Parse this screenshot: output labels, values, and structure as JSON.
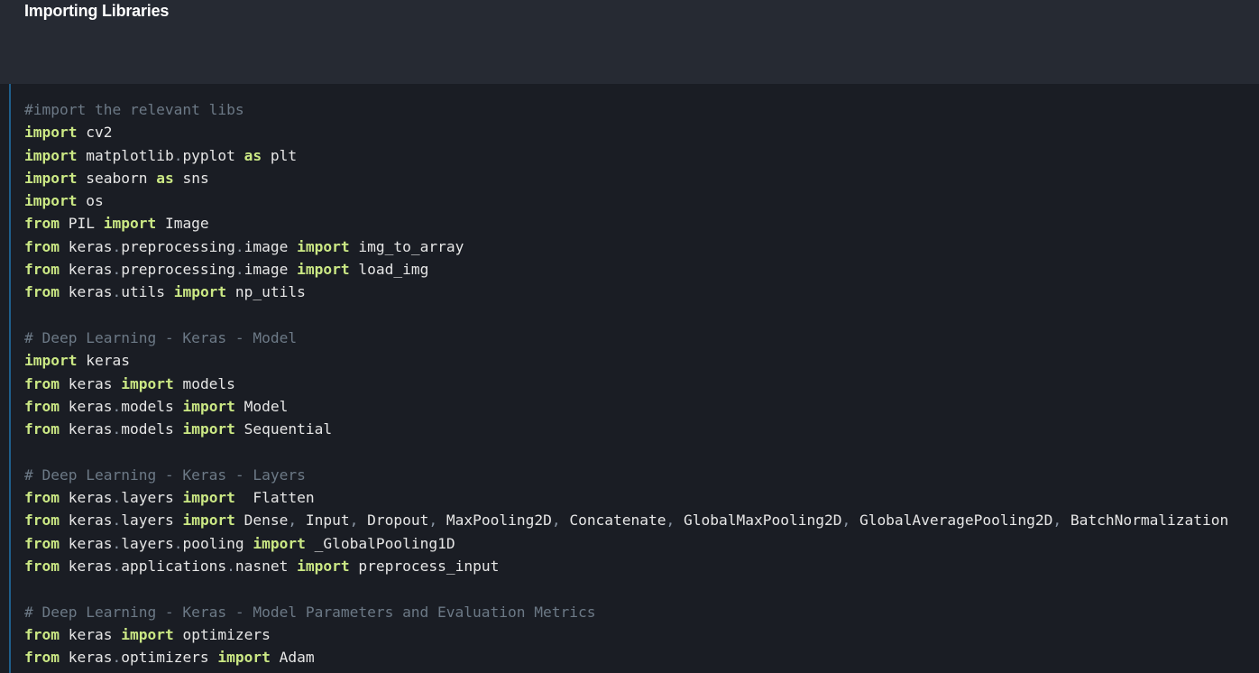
{
  "markdown": {
    "heading": "Importing Libraries"
  },
  "code": {
    "lines": [
      [
        {
          "t": "cm",
          "v": "#import the relevant libs"
        }
      ],
      [
        {
          "t": "kw",
          "v": "import"
        },
        {
          "t": "tx",
          "v": " cv2"
        }
      ],
      [
        {
          "t": "kw",
          "v": "import"
        },
        {
          "t": "tx",
          "v": " matplotlib"
        },
        {
          "t": "op",
          "v": "."
        },
        {
          "t": "tx",
          "v": "pyplot "
        },
        {
          "t": "kw",
          "v": "as"
        },
        {
          "t": "tx",
          "v": " plt"
        }
      ],
      [
        {
          "t": "kw",
          "v": "import"
        },
        {
          "t": "tx",
          "v": " seaborn "
        },
        {
          "t": "kw",
          "v": "as"
        },
        {
          "t": "tx",
          "v": " sns"
        }
      ],
      [
        {
          "t": "kw",
          "v": "import"
        },
        {
          "t": "tx",
          "v": " os"
        }
      ],
      [
        {
          "t": "kw",
          "v": "from"
        },
        {
          "t": "tx",
          "v": " PIL "
        },
        {
          "t": "kw",
          "v": "import"
        },
        {
          "t": "tx",
          "v": " Image"
        }
      ],
      [
        {
          "t": "kw",
          "v": "from"
        },
        {
          "t": "tx",
          "v": " keras"
        },
        {
          "t": "op",
          "v": "."
        },
        {
          "t": "tx",
          "v": "preprocessing"
        },
        {
          "t": "op",
          "v": "."
        },
        {
          "t": "tx",
          "v": "image "
        },
        {
          "t": "kw",
          "v": "import"
        },
        {
          "t": "tx",
          "v": " img_to_array"
        }
      ],
      [
        {
          "t": "kw",
          "v": "from"
        },
        {
          "t": "tx",
          "v": " keras"
        },
        {
          "t": "op",
          "v": "."
        },
        {
          "t": "tx",
          "v": "preprocessing"
        },
        {
          "t": "op",
          "v": "."
        },
        {
          "t": "tx",
          "v": "image "
        },
        {
          "t": "kw",
          "v": "import"
        },
        {
          "t": "tx",
          "v": " load_img"
        }
      ],
      [
        {
          "t": "kw",
          "v": "from"
        },
        {
          "t": "tx",
          "v": " keras"
        },
        {
          "t": "op",
          "v": "."
        },
        {
          "t": "tx",
          "v": "utils "
        },
        {
          "t": "kw",
          "v": "import"
        },
        {
          "t": "tx",
          "v": " np_utils"
        }
      ],
      [],
      [
        {
          "t": "cm",
          "v": "# Deep Learning - Keras - Model"
        }
      ],
      [
        {
          "t": "kw",
          "v": "import"
        },
        {
          "t": "tx",
          "v": " keras"
        }
      ],
      [
        {
          "t": "kw",
          "v": "from"
        },
        {
          "t": "tx",
          "v": " keras "
        },
        {
          "t": "kw",
          "v": "import"
        },
        {
          "t": "tx",
          "v": " models"
        }
      ],
      [
        {
          "t": "kw",
          "v": "from"
        },
        {
          "t": "tx",
          "v": " keras"
        },
        {
          "t": "op",
          "v": "."
        },
        {
          "t": "tx",
          "v": "models "
        },
        {
          "t": "kw",
          "v": "import"
        },
        {
          "t": "tx",
          "v": " Model"
        }
      ],
      [
        {
          "t": "kw",
          "v": "from"
        },
        {
          "t": "tx",
          "v": " keras"
        },
        {
          "t": "op",
          "v": "."
        },
        {
          "t": "tx",
          "v": "models "
        },
        {
          "t": "kw",
          "v": "import"
        },
        {
          "t": "tx",
          "v": " Sequential"
        }
      ],
      [],
      [
        {
          "t": "cm",
          "v": "# Deep Learning - Keras - Layers"
        }
      ],
      [
        {
          "t": "kw",
          "v": "from"
        },
        {
          "t": "tx",
          "v": " keras"
        },
        {
          "t": "op",
          "v": "."
        },
        {
          "t": "tx",
          "v": "layers "
        },
        {
          "t": "kw",
          "v": "import"
        },
        {
          "t": "tx",
          "v": "  Flatten"
        }
      ],
      [
        {
          "t": "kw",
          "v": "from"
        },
        {
          "t": "tx",
          "v": " keras"
        },
        {
          "t": "op",
          "v": "."
        },
        {
          "t": "tx",
          "v": "layers "
        },
        {
          "t": "kw",
          "v": "import"
        },
        {
          "t": "tx",
          "v": " Dense"
        },
        {
          "t": "op",
          "v": ","
        },
        {
          "t": "tx",
          "v": " Input"
        },
        {
          "t": "op",
          "v": ","
        },
        {
          "t": "tx",
          "v": " Dropout"
        },
        {
          "t": "op",
          "v": ","
        },
        {
          "t": "tx",
          "v": " MaxPooling2D"
        },
        {
          "t": "op",
          "v": ","
        },
        {
          "t": "tx",
          "v": " Concatenate"
        },
        {
          "t": "op",
          "v": ","
        },
        {
          "t": "tx",
          "v": " GlobalMaxPooling2D"
        },
        {
          "t": "op",
          "v": ","
        },
        {
          "t": "tx",
          "v": " GlobalAveragePooling2D"
        },
        {
          "t": "op",
          "v": ","
        },
        {
          "t": "tx",
          "v": " BatchNormalization"
        }
      ],
      [
        {
          "t": "kw",
          "v": "from"
        },
        {
          "t": "tx",
          "v": " keras"
        },
        {
          "t": "op",
          "v": "."
        },
        {
          "t": "tx",
          "v": "layers"
        },
        {
          "t": "op",
          "v": "."
        },
        {
          "t": "tx",
          "v": "pooling "
        },
        {
          "t": "kw",
          "v": "import"
        },
        {
          "t": "tx",
          "v": " _GlobalPooling1D"
        }
      ],
      [
        {
          "t": "kw",
          "v": "from"
        },
        {
          "t": "tx",
          "v": " keras"
        },
        {
          "t": "op",
          "v": "."
        },
        {
          "t": "tx",
          "v": "applications"
        },
        {
          "t": "op",
          "v": "."
        },
        {
          "t": "tx",
          "v": "nasnet "
        },
        {
          "t": "kw",
          "v": "import"
        },
        {
          "t": "tx",
          "v": " preprocess_input"
        }
      ],
      [],
      [
        {
          "t": "cm",
          "v": "# Deep Learning - Keras - Model Parameters and Evaluation Metrics"
        }
      ],
      [
        {
          "t": "kw",
          "v": "from"
        },
        {
          "t": "tx",
          "v": " keras "
        },
        {
          "t": "kw",
          "v": "import"
        },
        {
          "t": "tx",
          "v": " optimizers"
        }
      ],
      [
        {
          "t": "kw",
          "v": "from"
        },
        {
          "t": "tx",
          "v": " keras"
        },
        {
          "t": "op",
          "v": "."
        },
        {
          "t": "tx",
          "v": "optimizers "
        },
        {
          "t": "kw",
          "v": "import"
        },
        {
          "t": "tx",
          "v": " Adam"
        }
      ]
    ]
  },
  "colors": {
    "background": "#1a1d24",
    "markdown_background": "#262a33",
    "keyword": "#cbe884",
    "comment": "#6c7986",
    "text": "#e6e6e6",
    "punctuation": "#8a95a3",
    "cell_rail": "#1f5f8b"
  }
}
